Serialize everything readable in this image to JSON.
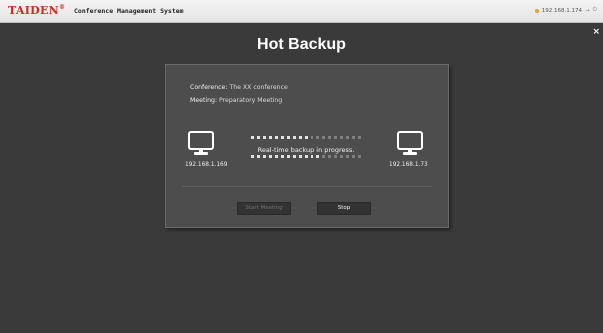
{
  "topbar": {
    "brand": "TAIDEN",
    "brand_mark": "®",
    "subtitle": "Conference Management System",
    "ip": "192.168.1.174",
    "status_color": "#f0a020"
  },
  "page": {
    "title": "Hot Backup",
    "close_symbol": "×"
  },
  "dialog": {
    "conference_label": "Conference:",
    "conference_value": "The XX conference",
    "meeting_label": "Meeting:",
    "meeting_value": "Preparatory Meeting",
    "left_ip": "192.168.1.169",
    "right_ip": "192.168.1.73",
    "progress_text": "Real-time backup in progress.",
    "start_button": "Start Meeting",
    "stop_button": "Stop"
  },
  "icons": {
    "source": "monitor-icon",
    "target": "monitor-icon",
    "close": "close-icon"
  },
  "colors": {
    "background": "#3a3a3a",
    "dialog": "#4d4d4d",
    "brand": "#d2281e"
  }
}
